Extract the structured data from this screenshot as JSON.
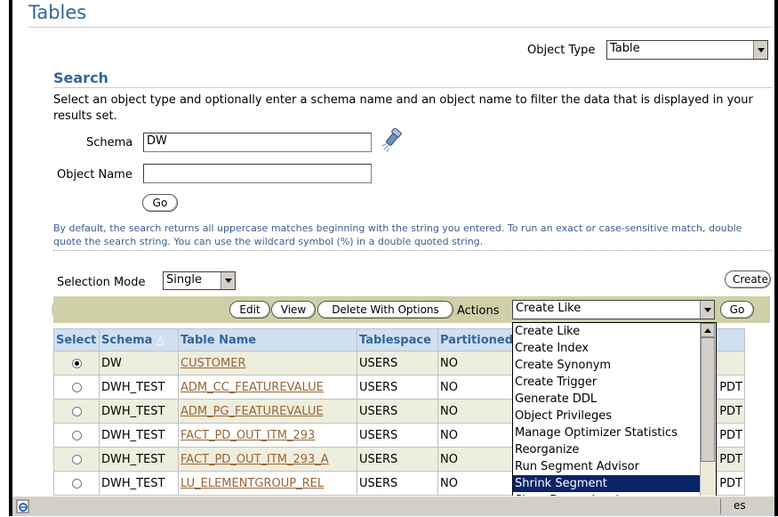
{
  "page": {
    "title": "Tables"
  },
  "object_type": {
    "label": "Object Type",
    "value": "Table"
  },
  "search": {
    "title": "Search",
    "description": "Select an object type and optionally enter a schema name and an object name to filter the data that is displayed in your results set.",
    "schema_label": "Schema",
    "schema_value": "DW",
    "object_name_label": "Object Name",
    "object_name_value": "",
    "go_label": "Go",
    "hint": "By default, the search returns all uppercase matches beginning with the string you entered. To run an exact or case-sensitive match, double quote the search string. You can use the wildcard symbol (%) in a double quoted string."
  },
  "selection_mode": {
    "label": "Selection Mode",
    "value": "Single"
  },
  "create_label": "Create",
  "toolbar": {
    "edit_label": "Edit",
    "view_label": "View",
    "delete_label": "Delete With Options",
    "actions_label": "Actions",
    "actions_value": "Create Like",
    "go_label": "Go"
  },
  "table": {
    "headers": [
      "Select",
      "Schema",
      "Table Name",
      "Tablespace",
      "Partitioned"
    ],
    "rows": [
      {
        "selected": true,
        "schema": "DW",
        "table_name": "CUSTOMER",
        "tablespace": "USERS",
        "partitioned": "NO",
        "last": ""
      },
      {
        "selected": false,
        "schema": "DWH_TEST",
        "table_name": "ADM_CC_FEATUREVALUE",
        "tablespace": "USERS",
        "partitioned": "NO",
        "last": "PM PDT"
      },
      {
        "selected": false,
        "schema": "DWH_TEST",
        "table_name": "ADM_PG_FEATUREVALUE",
        "tablespace": "USERS",
        "partitioned": "NO",
        "last": "PM PDT"
      },
      {
        "selected": false,
        "schema": "DWH_TEST",
        "table_name": "FACT_PD_OUT_ITM_293",
        "tablespace": "USERS",
        "partitioned": "NO",
        "last": "PM PDT"
      },
      {
        "selected": false,
        "schema": "DWH_TEST",
        "table_name": "FACT_PD_OUT_ITM_293_A",
        "tablespace": "USERS",
        "partitioned": "NO",
        "last": "PM PDT"
      },
      {
        "selected": false,
        "schema": "DWH_TEST",
        "table_name": "LU_ELEMENTGROUP_REL",
        "tablespace": "USERS",
        "partitioned": "NO",
        "last": "PM PDT"
      }
    ]
  },
  "actions_dropdown": {
    "options": [
      "Create Like",
      "Create Index",
      "Create Synonym",
      "Create Trigger",
      "Generate DDL",
      "Object Privileges",
      "Manage Optimizer Statistics",
      "Reorganize",
      "Run Segment Advisor",
      "Shrink Segment",
      "Show Dependencies"
    ],
    "highlighted": "Shrink Segment"
  },
  "statusbar": {
    "text": "es"
  },
  "colors": {
    "accent": "#336699",
    "link": "#996633",
    "highlight": "#0a246a",
    "band": "#cfcfa8"
  }
}
